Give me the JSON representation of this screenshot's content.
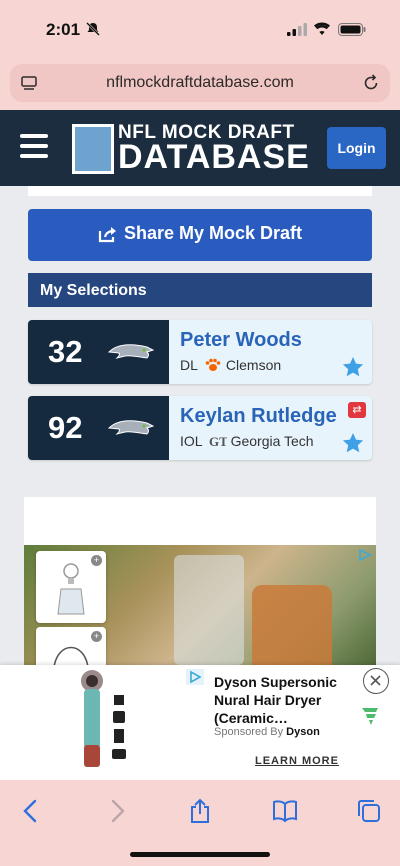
{
  "status": {
    "time": "2:01"
  },
  "browser": {
    "url": "nflmockdraftdatabase.com"
  },
  "header": {
    "logo_top": "NFL MOCK DRAFT",
    "logo_bottom": "DATABASE",
    "login_label": "Login"
  },
  "share": {
    "label": "Share My Mock Draft"
  },
  "selections": {
    "title": "My Selections",
    "picks": [
      {
        "number": "32",
        "team_logo": "seahawks-logo",
        "name": "Peter Woods",
        "position": "DL",
        "school": "Clemson",
        "school_icon": "paw-icon"
      },
      {
        "number": "92",
        "team_logo": "seahawks-logo",
        "name": "Keylan Rutledge",
        "position": "IOL",
        "school": "Georgia Tech",
        "school_icon": "gt-logo"
      }
    ]
  },
  "banner": {
    "title": "Dyson Supersonic Nural Hair Dryer (Ceramic…",
    "sponsored_prefix": "Sponsored By",
    "sponsor": "Dyson",
    "cta": "LEARN MORE"
  },
  "colors": {
    "header_bg": "#1b2d3e",
    "share_bg": "#2a5bbf",
    "pick_name": "#2a64b8",
    "login_bg": "#2a66c4"
  }
}
